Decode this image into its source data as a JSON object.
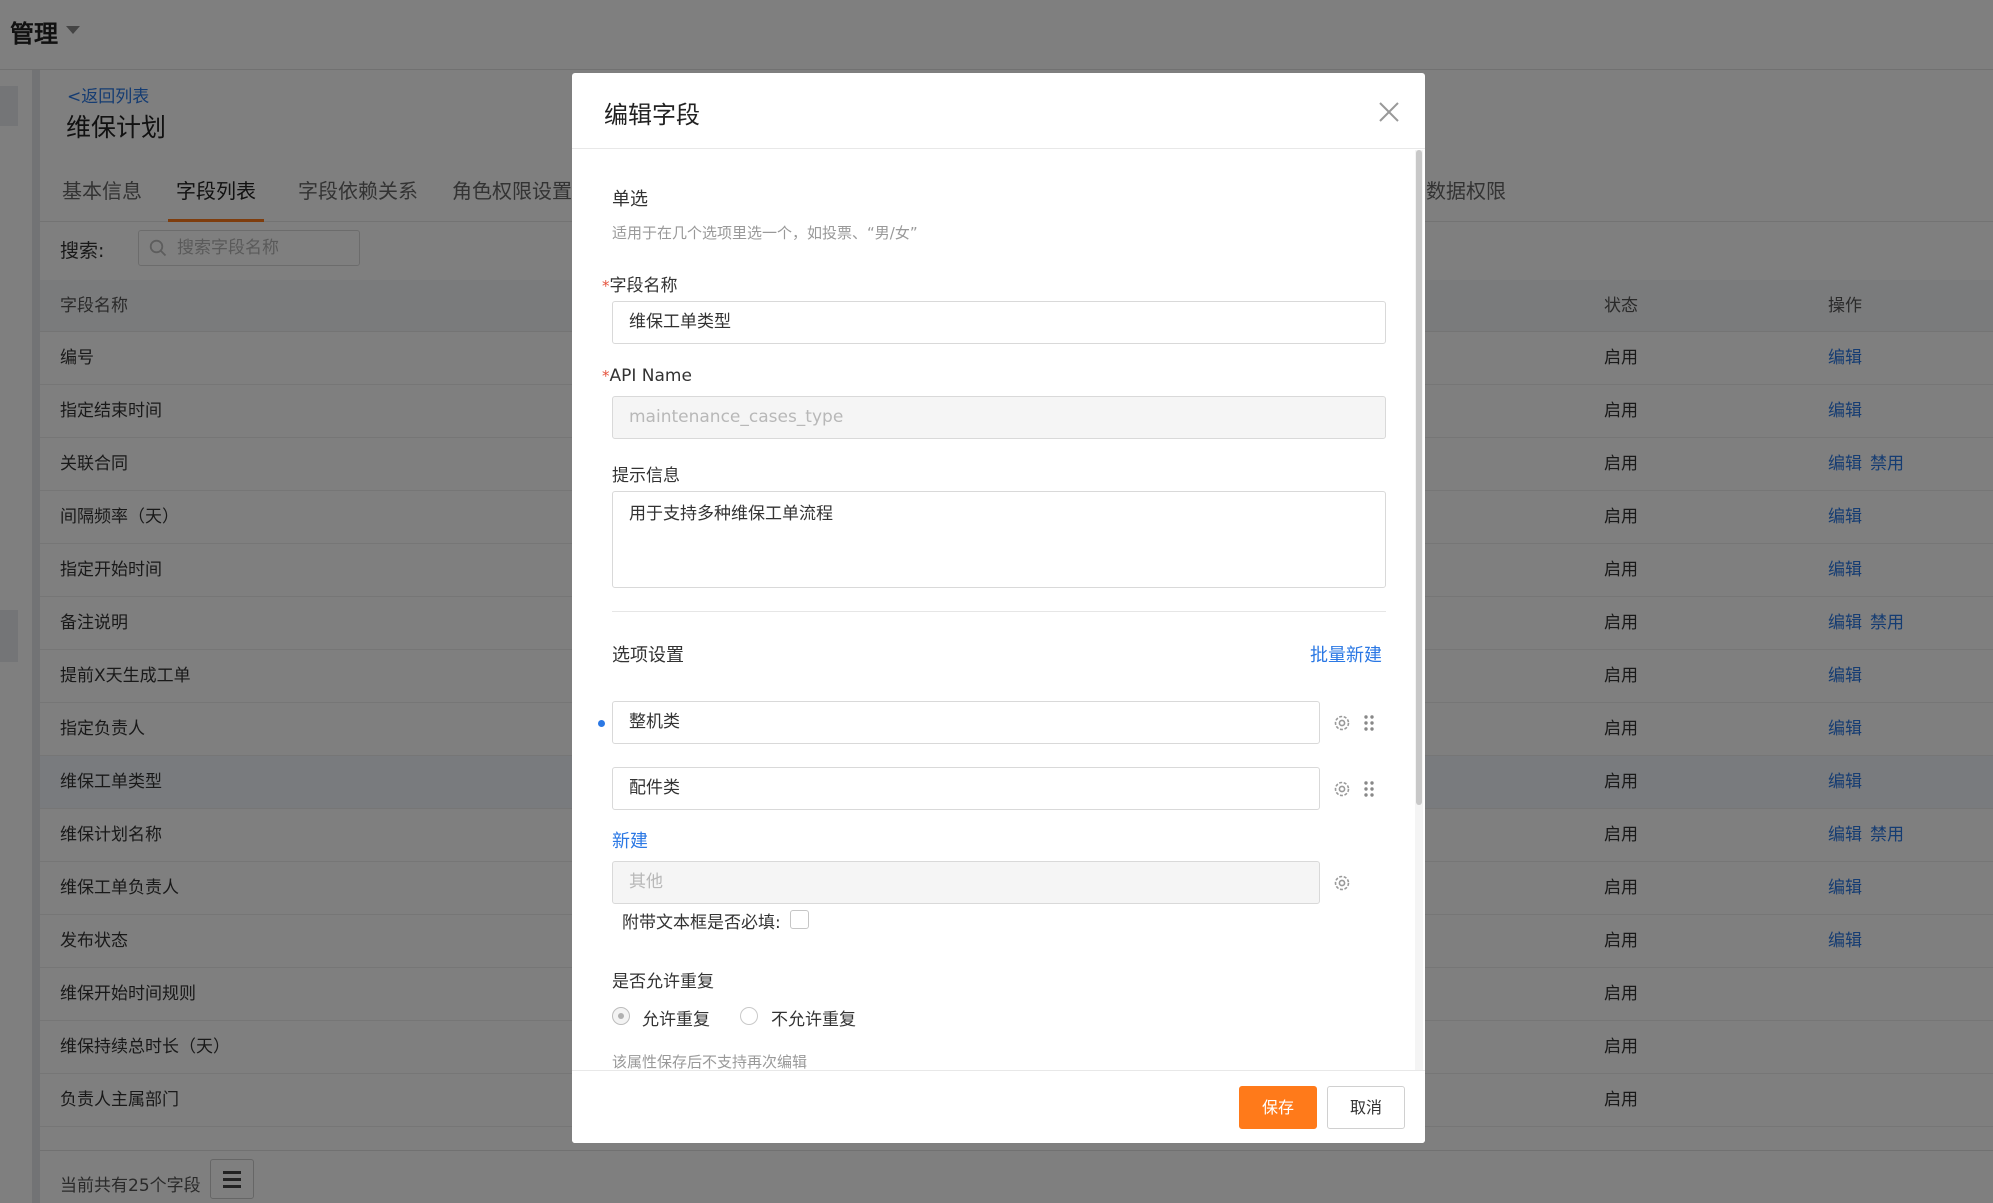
{
  "topbar": {
    "title": "管理"
  },
  "page": {
    "back_link": "<返回列表",
    "title": "维保计划",
    "tabs": [
      {
        "label": "基本信息",
        "active": false
      },
      {
        "label": "字段列表",
        "active": true
      },
      {
        "label": "字段依赖关系",
        "active": false
      },
      {
        "label": "角色权限设置",
        "active": false
      },
      {
        "label": "数据权限",
        "active": false
      }
    ],
    "search": {
      "label": "搜索:",
      "placeholder": "搜索字段名称"
    }
  },
  "table": {
    "headers": {
      "name": "字段名称",
      "status": "状态",
      "action": "操作"
    },
    "rows": [
      {
        "name": "编号",
        "status": "启用",
        "edit": "编辑",
        "disable": ""
      },
      {
        "name": "指定结束时间",
        "status": "启用",
        "edit": "编辑",
        "disable": ""
      },
      {
        "name": "关联合同",
        "status": "启用",
        "edit": "编辑",
        "disable": "禁用"
      },
      {
        "name": "间隔频率（天）",
        "status": "启用",
        "edit": "编辑",
        "disable": ""
      },
      {
        "name": "指定开始时间",
        "status": "启用",
        "edit": "编辑",
        "disable": ""
      },
      {
        "name": "备注说明",
        "status": "启用",
        "edit": "编辑",
        "disable": "禁用"
      },
      {
        "name": "提前X天生成工单",
        "status": "启用",
        "edit": "编辑",
        "disable": ""
      },
      {
        "name": "指定负责人",
        "status": "启用",
        "edit": "编辑",
        "disable": ""
      },
      {
        "name": "维保工单类型",
        "status": "启用",
        "edit": "编辑",
        "disable": ""
      },
      {
        "name": "维保计划名称",
        "status": "启用",
        "edit": "编辑",
        "disable": "禁用"
      },
      {
        "name": "维保工单负责人",
        "status": "启用",
        "edit": "编辑",
        "disable": ""
      },
      {
        "name": "发布状态",
        "status": "启用",
        "edit": "编辑",
        "disable": ""
      },
      {
        "name": "维保开始时间规则",
        "status": "启用",
        "edit": "",
        "disable": ""
      },
      {
        "name": "维保持续总时长（天）",
        "status": "启用",
        "edit": "",
        "disable": ""
      },
      {
        "name": "负责人主属部门",
        "status": "启用",
        "edit": "",
        "disable": ""
      }
    ],
    "highlighted_row": 8
  },
  "footer": {
    "count_text": "当前共有25个字段"
  },
  "modal": {
    "title": "编辑字段",
    "type_title": "单选",
    "type_desc": "适用于在几个选项里选一个，如投票、“男/女”",
    "required_mark": "*",
    "field_name": {
      "label": "字段名称",
      "value": "维保工单类型"
    },
    "api_name": {
      "label": "API Name",
      "value": "maintenance_cases_type"
    },
    "hint_info": {
      "label": "提示信息",
      "value": "用于支持多种维保工单流程"
    },
    "options_section": {
      "title": "选项设置",
      "batch_create": "批量新建",
      "options": [
        "整机类",
        "配件类"
      ],
      "new_link": "新建",
      "other_placeholder": "其他",
      "extra_text_label": "附带文本框是否必填:"
    },
    "duplicate": {
      "title": "是否允许重复",
      "allow": "允许重复",
      "disallow": "不允许重复",
      "selected": "allow",
      "hint": "该属性保存后不支持再次编辑"
    },
    "buttons": {
      "save": "保存",
      "cancel": "取消"
    }
  },
  "colors": {
    "accent": "#ff7a1a",
    "link": "#2b78e4"
  }
}
